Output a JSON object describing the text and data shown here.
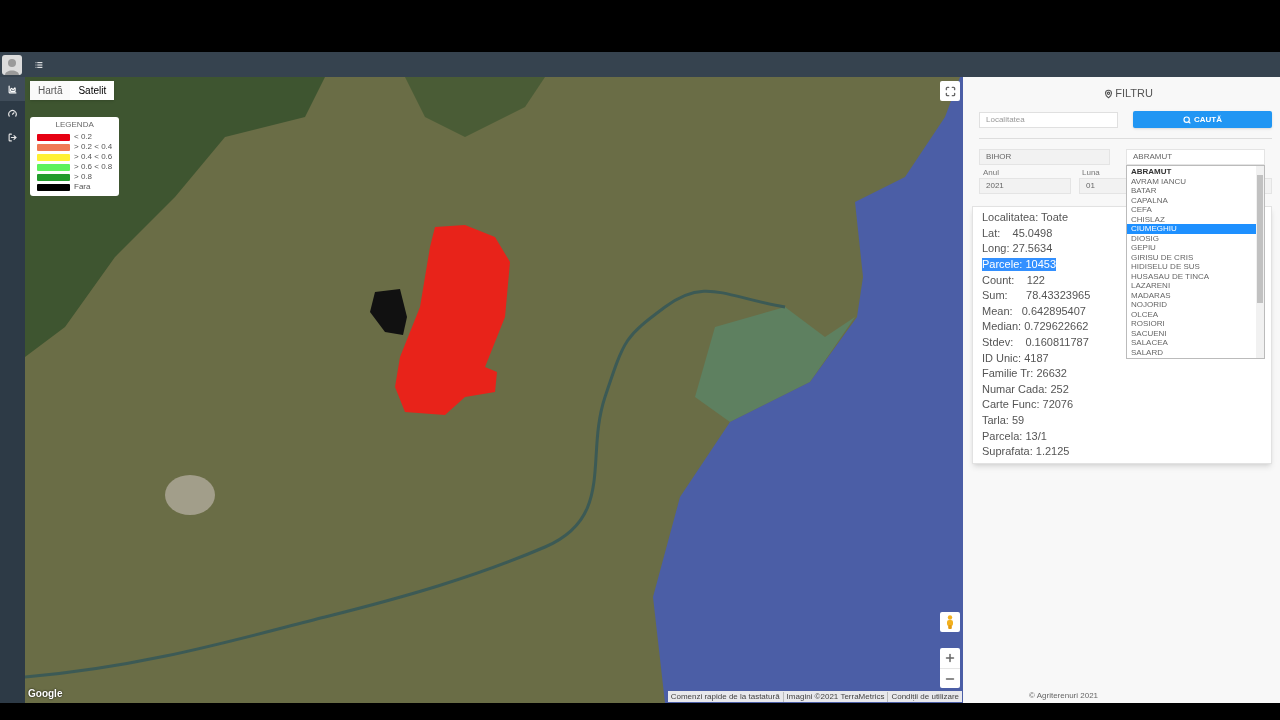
{
  "sidebar": {
    "items": [
      {
        "selected": true
      },
      {
        "selected": false
      },
      {
        "selected": false
      }
    ]
  },
  "map": {
    "map_types": [
      {
        "label": "Hartă",
        "selected": false
      },
      {
        "label": "Satelit",
        "selected": true
      }
    ],
    "legend": {
      "title": "LEGENDA",
      "items": [
        {
          "label": "< 0.2",
          "color": "#e60012"
        },
        {
          "label": "> 0.2 < 0.4",
          "color": "#f07a55"
        },
        {
          "label": "> 0.4 < 0.6",
          "color": "#fff133"
        },
        {
          "label": "> 0.6 < 0.8",
          "color": "#5cf25c"
        },
        {
          "label": "> 0.8",
          "color": "#229a2c"
        },
        {
          "label": "Fara",
          "color": "#000000"
        }
      ]
    },
    "logo": "Google",
    "attribution": [
      "Comenzi rapide de la tastatură",
      "Imagini ©2021 TerraMetrics",
      "Condiții de utilizare"
    ]
  },
  "filter": {
    "title": "FILTRU",
    "search": {
      "placeholder": "Localitatea"
    },
    "search_button": "CAUTĂ",
    "county_select": {
      "value": "BIHOR"
    },
    "locality_select": {
      "value": "ABRAMUT",
      "expanded": true,
      "options": [
        {
          "label": "ABRAMUT",
          "selected": true,
          "highlighted": false
        },
        {
          "label": "AVRAM IANCU",
          "selected": false,
          "highlighted": false
        },
        {
          "label": "BATAR",
          "selected": false,
          "highlighted": false
        },
        {
          "label": "CAPALNA",
          "selected": false,
          "highlighted": false
        },
        {
          "label": "CEFA",
          "selected": false,
          "highlighted": false
        },
        {
          "label": "CHISLAZ",
          "selected": false,
          "highlighted": false
        },
        {
          "label": "CIUMEGHIU",
          "selected": false,
          "highlighted": true
        },
        {
          "label": "DIOSIG",
          "selected": false,
          "highlighted": false
        },
        {
          "label": "GEPIU",
          "selected": false,
          "highlighted": false
        },
        {
          "label": "GIRISU DE CRIS",
          "selected": false,
          "highlighted": false
        },
        {
          "label": "HIDISELU DE SUS",
          "selected": false,
          "highlighted": false
        },
        {
          "label": "HUSASAU DE TINCA",
          "selected": false,
          "highlighted": false
        },
        {
          "label": "LAZARENI",
          "selected": false,
          "highlighted": false
        },
        {
          "label": "MADARAS",
          "selected": false,
          "highlighted": false
        },
        {
          "label": "NOJORID",
          "selected": false,
          "highlighted": false
        },
        {
          "label": "OLCEA",
          "selected": false,
          "highlighted": false
        },
        {
          "label": "ROSIORI",
          "selected": false,
          "highlighted": false
        },
        {
          "label": "SACUENI",
          "selected": false,
          "highlighted": false
        },
        {
          "label": "SALACEA",
          "selected": false,
          "highlighted": false
        },
        {
          "label": "SALARD",
          "selected": false,
          "highlighted": false
        }
      ]
    },
    "year": {
      "label": "Anul",
      "value": "2021"
    },
    "month": {
      "label": "Luna",
      "value": "01"
    }
  },
  "info": {
    "lines": [
      {
        "text": "Localitatea: Toate",
        "highlighted": false
      },
      {
        "text": "Lat:    45.0498",
        "highlighted": false
      },
      {
        "text": "Long: 27.5634",
        "highlighted": false
      },
      {
        "text": "Parcele: 10453",
        "highlighted": true
      },
      {
        "text": "Count:    122",
        "highlighted": false
      },
      {
        "text": "Sum:      78.43323965",
        "highlighted": false
      },
      {
        "text": "Mean:   0.642895407",
        "highlighted": false
      },
      {
        "text": "Median: 0.729622662",
        "highlighted": false
      },
      {
        "text": "Stdev:    0.160811787",
        "highlighted": false
      },
      {
        "text": "ID Unic: 4187",
        "highlighted": false
      },
      {
        "text": "Familie Tr: 26632",
        "highlighted": false
      },
      {
        "text": "Numar Cada: 252",
        "highlighted": false
      },
      {
        "text": "Carte Func: 72076",
        "highlighted": false
      },
      {
        "text": "Tarla: 59",
        "highlighted": false
      },
      {
        "text": "Parcela: 13/1",
        "highlighted": false
      },
      {
        "text": "Suprafata: 1.2125",
        "highlighted": false
      }
    ]
  },
  "footer": "© Agriterenuri 2021"
}
